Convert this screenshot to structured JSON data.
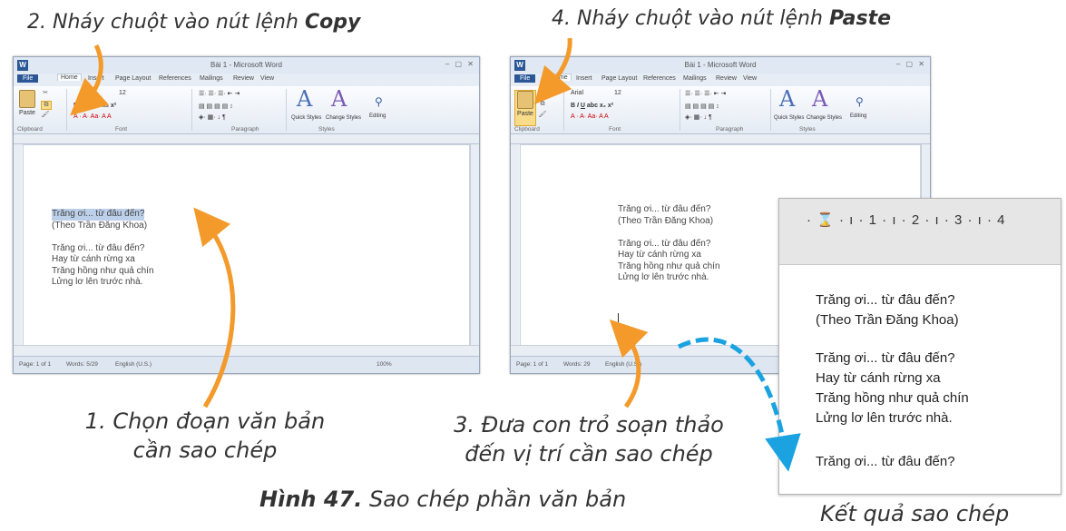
{
  "captions": {
    "step1_line1": "1. Chọn đoạn văn bản",
    "step1_line2": "cần sao chép",
    "step2_prefix": "2. Nháy chuột vào nút lệnh ",
    "step2_command": "Copy",
    "step3_line1": "3. Đưa con trỏ soạn thảo",
    "step3_line2": "đến vị trí cần sao chép",
    "step4_prefix": "4. Nháy chuột vào nút lệnh ",
    "step4_command": "Paste",
    "figure_label": "Hình 47.",
    "figure_text": " Sao chép phần văn bản",
    "result_label": "Kết quả sao chép"
  },
  "word_window_left": {
    "title": "Bài 1 - Microsoft Word",
    "tabs": [
      "File",
      "Home",
      "Insert",
      "Page Layout",
      "References",
      "Mailings",
      "Review",
      "View"
    ],
    "paste_label": "Paste",
    "groups": [
      "Clipboard",
      "Font",
      "Paragraph",
      "Styles"
    ],
    "font_size": "12",
    "quick_styles": "Quick Styles",
    "change_styles": "Change Styles",
    "editing": "Editing",
    "status_page": "Page: 1 of 1",
    "status_words": "Words: 5/29",
    "status_lang": "English (U.S.)",
    "status_zoom": "100%",
    "poem": [
      "Trăng ơi... từ đâu đến?",
      "(Theo Trần Đăng Khoa)",
      "",
      "Trăng ơi... từ đâu đến?",
      "Hay từ cánh rừng xa",
      "Trăng hồng như quả chín",
      "Lửng lơ lên trước nhà."
    ]
  },
  "word_window_right": {
    "title": "Bài 1 - Microsoft Word",
    "tabs": [
      "File",
      "Home",
      "Insert",
      "Page Layout",
      "References",
      "Mailings",
      "Review",
      "View"
    ],
    "paste_label": "Paste",
    "font_name": "Arial",
    "font_size": "12",
    "groups": [
      "Clipboard",
      "Font",
      "Paragraph",
      "Styles"
    ],
    "quick_styles": "Quick Styles",
    "change_styles": "Change Styles",
    "editing": "Editing",
    "status_page": "Page: 1 of 1",
    "status_words": "Words: 29",
    "status_lang": "English (U.S.)",
    "poem": [
      "Trăng ơi... từ đâu đến?",
      "(Theo Trần Đăng Khoa)",
      "",
      "Trăng ơi... từ đâu đến?",
      "Hay từ cánh rừng xa",
      "Trăng hồng như quả chín",
      "Lửng lơ lên trước nhà."
    ]
  },
  "zoom_result": {
    "ruler_ticks": "· ⌛ · ı · 1 · ı · 2 · ı · 3 · ı · 4",
    "lines": [
      "Trăng ơi... từ đâu đến?",
      "(Theo Trần Đăng Khoa)",
      "",
      "Trăng ơi... từ đâu đến?",
      "Hay từ cánh rừng xa",
      "Trăng hồng như quả chín",
      "Lửng lơ lên trước nhà.",
      "",
      "Trăng ơi... từ đâu đến?"
    ]
  },
  "colors": {
    "arrow_orange": "#f39a2b",
    "arrow_blue": "#1aa3e0",
    "selection": "#bcd0ea",
    "file_tab": "#2b5797"
  }
}
